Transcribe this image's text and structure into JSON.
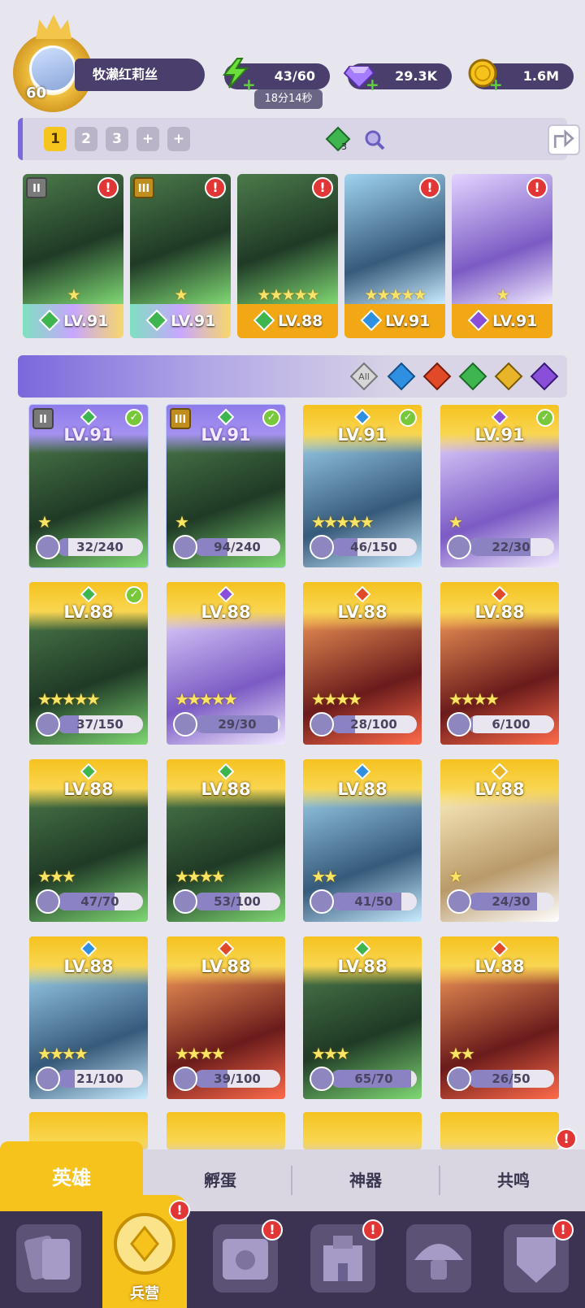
{
  "player": {
    "level": "60",
    "name": "牧濑红莉丝"
  },
  "resources": {
    "energy": "43/60",
    "energy_timer": "18分14秒",
    "gems": "29.3K",
    "gold": "1.6M"
  },
  "team_bar": {
    "tabs": [
      "1",
      "2",
      "3",
      "+",
      "+"
    ],
    "active_tab": "1",
    "gem_badge": "3"
  },
  "team": [
    {
      "level": "LV.91",
      "rank": "II",
      "element": "green",
      "alert": "!",
      "stars": "★"
    },
    {
      "level": "LV.91",
      "rank": "III",
      "element": "green",
      "alert": "!",
      "stars": "★"
    },
    {
      "level": "LV.88",
      "rank": "",
      "element": "green",
      "alert": "!",
      "stars": "★★★★★"
    },
    {
      "level": "LV.91",
      "rank": "",
      "element": "blue",
      "alert": "!",
      "stars": "★★★★★"
    },
    {
      "level": "LV.91",
      "rank": "",
      "element": "purple",
      "alert": "!",
      "stars": "★"
    }
  ],
  "filter": {
    "all_label": "All",
    "elements": [
      "blue",
      "red",
      "green",
      "gold",
      "purple"
    ]
  },
  "heroes": [
    {
      "level": "LV.91",
      "shards": "32/240",
      "progress": 0.13,
      "element": "green",
      "checked": true,
      "rank": "II",
      "stars": "★"
    },
    {
      "level": "LV.91",
      "shards": "94/240",
      "progress": 0.39,
      "element": "green",
      "checked": true,
      "rank": "III",
      "stars": "★"
    },
    {
      "level": "LV.91",
      "shards": "46/150",
      "progress": 0.31,
      "element": "blue",
      "checked": true,
      "rank": "",
      "stars": "★★★★★"
    },
    {
      "level": "LV.91",
      "shards": "22/30",
      "progress": 0.73,
      "element": "purple",
      "checked": true,
      "rank": "",
      "stars": "★"
    },
    {
      "level": "LV.88",
      "shards": "37/150",
      "progress": 0.25,
      "element": "green",
      "checked": true,
      "rank": "",
      "stars": "★★★★★"
    },
    {
      "level": "LV.88",
      "shards": "29/30",
      "progress": 0.97,
      "element": "purple",
      "checked": false,
      "rank": "",
      "stars": "★★★★★"
    },
    {
      "level": "LV.88",
      "shards": "28/100",
      "progress": 0.28,
      "element": "red",
      "checked": false,
      "rank": "",
      "stars": "★★★★"
    },
    {
      "level": "LV.88",
      "shards": "6/100",
      "progress": 0.06,
      "element": "red",
      "checked": false,
      "rank": "",
      "stars": "★★★★"
    },
    {
      "level": "LV.88",
      "shards": "47/70",
      "progress": 0.67,
      "element": "green",
      "checked": false,
      "rank": "",
      "stars": "★★★"
    },
    {
      "level": "LV.88",
      "shards": "53/100",
      "progress": 0.53,
      "element": "green",
      "checked": false,
      "rank": "",
      "stars": "★★★★"
    },
    {
      "level": "LV.88",
      "shards": "41/50",
      "progress": 0.82,
      "element": "blue",
      "checked": false,
      "rank": "",
      "stars": "★★"
    },
    {
      "level": "LV.88",
      "shards": "24/30",
      "progress": 0.8,
      "element": "gold",
      "checked": false,
      "rank": "",
      "stars": "★"
    },
    {
      "level": "LV.88",
      "shards": "21/100",
      "progress": 0.21,
      "element": "blue",
      "checked": false,
      "rank": "",
      "stars": "★★★★"
    },
    {
      "level": "LV.88",
      "shards": "39/100",
      "progress": 0.39,
      "element": "red",
      "checked": false,
      "rank": "",
      "stars": "★★★★"
    },
    {
      "level": "LV.88",
      "shards": "65/70",
      "progress": 0.93,
      "element": "green",
      "checked": false,
      "rank": "",
      "stars": "★★★"
    },
    {
      "level": "LV.88",
      "shards": "26/50",
      "progress": 0.52,
      "element": "red",
      "checked": false,
      "rank": "",
      "stars": "★★"
    }
  ],
  "tabs": [
    {
      "label": "英雄",
      "active": true
    },
    {
      "label": "孵蛋",
      "active": false
    },
    {
      "label": "神器",
      "active": false
    },
    {
      "label": "共鸣",
      "active": false
    }
  ],
  "nav": {
    "active_label": "兵营"
  },
  "colors": {
    "gold": "#f6c21c",
    "purple": "#7a68dc",
    "dark": "#3c3352",
    "el_green": "#3fb550",
    "el_blue": "#2f8fe0",
    "el_red": "#e04a28",
    "el_purple": "#8a4fd8",
    "el_gold": "#e8b42a"
  }
}
